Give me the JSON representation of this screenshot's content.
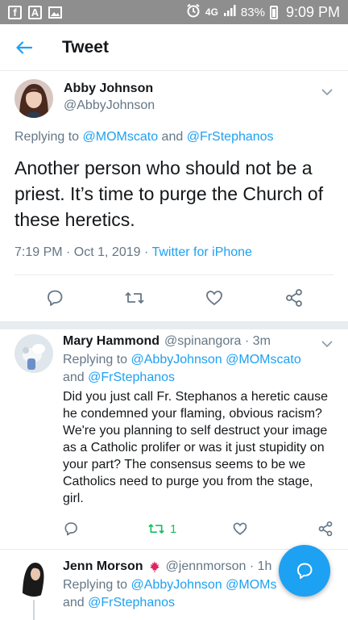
{
  "status_bar": {
    "left_icons": [
      "facebook-icon",
      "text-a-icon",
      "gallery-icon"
    ],
    "right_icons": [
      "alarm-icon",
      "4g-icon",
      "signal-icon",
      "battery-icon"
    ],
    "network": "4G",
    "battery": "83%",
    "time": "9:09 PM"
  },
  "header": {
    "title": "Tweet"
  },
  "main_tweet": {
    "name": "Abby Johnson",
    "handle": "@AbbyJohnson",
    "replying_prefix": "Replying to",
    "replying_to_1": "@MOMscato",
    "replying_and": "and",
    "replying_to_2": "@FrStephanos",
    "text": "Another person who should not be a priest. It’s time to purge the Church of these heretics.",
    "time": "7:19 PM · Oct 1, 2019 ·",
    "source": "Twitter for iPhone"
  },
  "replies": [
    {
      "name": "Mary Hammond",
      "handle": "@spinangora · 3m",
      "replying_prefix": "Replying to",
      "replying_to_1": "@AbbyJohnson",
      "replying_to_2": "@MOMscato",
      "replying_and": "and",
      "replying_to_3": "@FrStephanos",
      "text": "Did you just call Fr. Stephanos a heretic cause he condemned your flaming, obvious racism? We're you planning to self destruct your image as a Catholic prolifer or was it just stupidity on your part? The consensus seems to be we Catholics need to purge you from the stage, girl.",
      "retweet_count": "1"
    },
    {
      "name": "Jenn Morson",
      "handle": "@jennmorson · 1h",
      "replying_prefix": "Replying to",
      "replying_to_1": "@AbbyJohnson",
      "replying_to_2": "@MOMs",
      "replying_and": "and",
      "replying_to_3": "@FrStephanos"
    }
  ],
  "colors": {
    "accent": "#1da1f2",
    "retweet_active": "#17bf63",
    "secondary_text": "#657786"
  }
}
